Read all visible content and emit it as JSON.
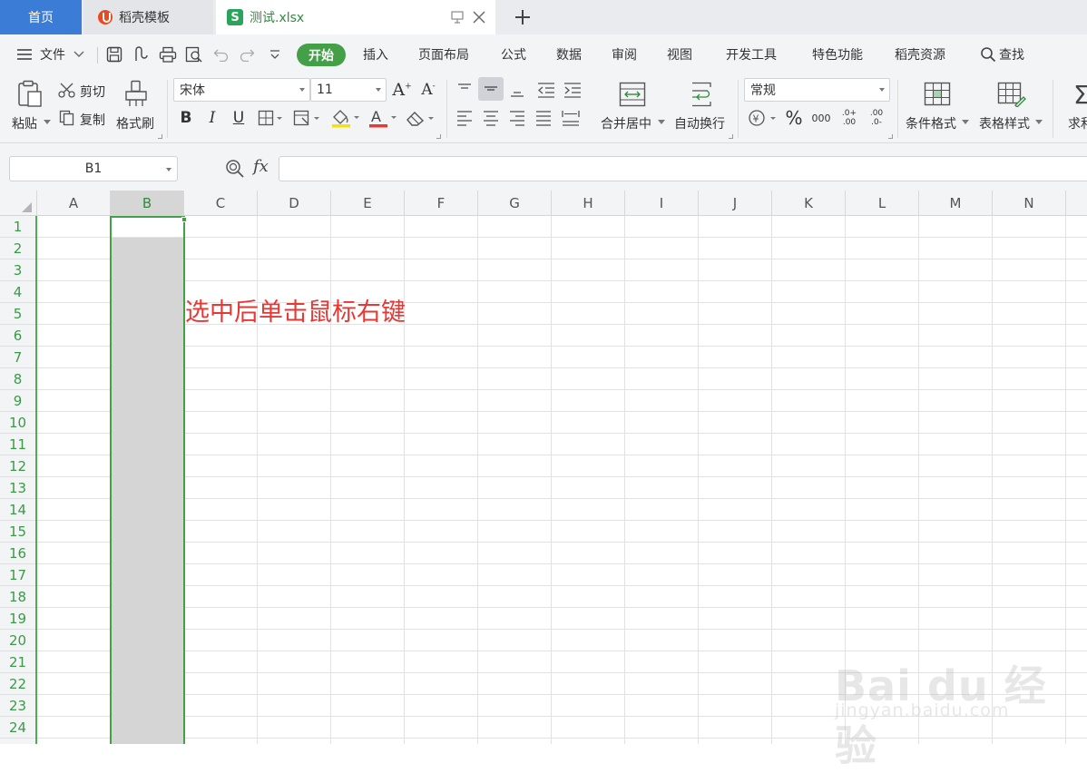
{
  "tabs": {
    "home": "首页",
    "template": "稻壳模板",
    "file": "测试.xlsx",
    "new_tab_symbol": "+"
  },
  "menu": {
    "file_label": "文件",
    "items": [
      "开始",
      "插入",
      "页面布局",
      "公式",
      "数据",
      "审阅",
      "视图",
      "开发工具",
      "特色功能",
      "稻壳资源"
    ],
    "search_label": "查找"
  },
  "ribbon": {
    "paste": "粘贴",
    "cut": "剪切",
    "copy": "复制",
    "format_painter": "格式刷",
    "font_name": "宋体",
    "font_size": "11",
    "bold": "B",
    "italic": "I",
    "underline": "U",
    "merge_center": "合并居中",
    "wrap_text": "自动换行",
    "number_format": "常规",
    "percent": "%",
    "thousands": "000",
    "inc_decimal": ".0+ .00",
    "dec_decimal": ".00 .0-",
    "conditional_format": "条件格式",
    "table_style": "表格样式",
    "sum_partial": "求和"
  },
  "formula_bar": {
    "name_box": "B1",
    "fx": "fx",
    "formula": ""
  },
  "grid": {
    "columns": [
      "A",
      "B",
      "C",
      "D",
      "E",
      "F",
      "G",
      "H",
      "I",
      "J",
      "K",
      "L",
      "M",
      "N"
    ],
    "rows": [
      "1",
      "2",
      "3",
      "4",
      "5",
      "6",
      "7",
      "8",
      "9",
      "10",
      "11",
      "12",
      "13",
      "14",
      "15",
      "16",
      "17",
      "18",
      "19",
      "20",
      "21",
      "22",
      "23",
      "24"
    ],
    "selected_column": "B",
    "annotation": "选中后单击鼠标右键"
  },
  "watermark": {
    "brand": "Bai du 经验",
    "url": "jingyan.baidu.com"
  },
  "colors": {
    "accent_green": "#43a047",
    "home_tab_blue": "#3b7cd6",
    "annotation_red": "#e53935"
  }
}
